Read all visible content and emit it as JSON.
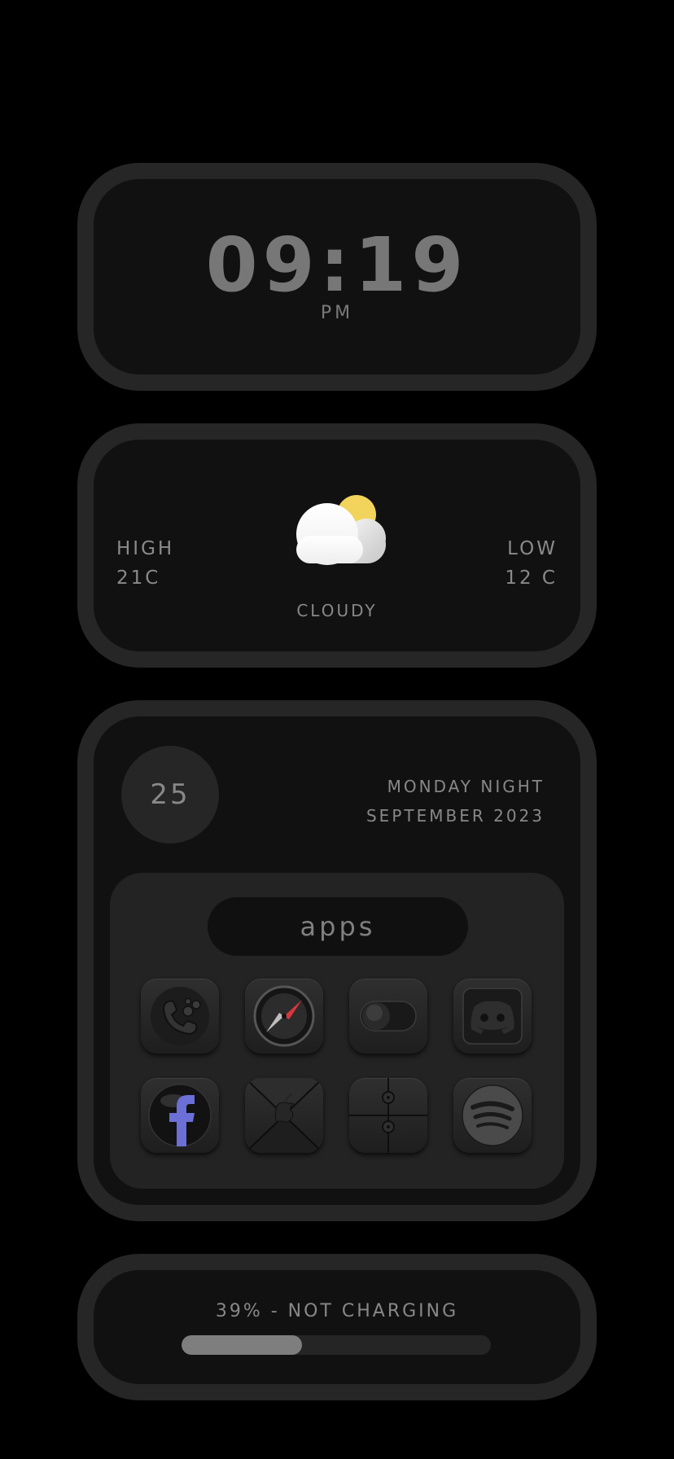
{
  "clock": {
    "time": "09:19",
    "ampm": "pm"
  },
  "weather": {
    "high_label": "HIGH",
    "high_value": "21C",
    "low_label": "LOW",
    "low_value": "12 C",
    "condition": "CLOUDY",
    "icon": "partly-cloudy-icon",
    "sun_color": "#f2d45c",
    "cloud_color": "#ffffff"
  },
  "date": {
    "day_number": "25",
    "line1": "MONDAY NIGHT",
    "line2": "SEPTEMBER 2023"
  },
  "apps": {
    "title": "apps",
    "icons": [
      "phone-icon",
      "safari-compass-icon",
      "toggle-settings-icon",
      "discord-icon",
      "facebook-icon",
      "mail-icon",
      "dots-icon",
      "spotify-icon"
    ]
  },
  "battery": {
    "text": "39% - NOT CHARGING",
    "level": 0.39
  },
  "colors": {
    "background": "#000000",
    "widget_border": "#262626",
    "widget_fill": "#111111",
    "text": "#7c7c7c",
    "facebook_accent": "#6b6fd6",
    "safari_needle": "#d9363e"
  }
}
